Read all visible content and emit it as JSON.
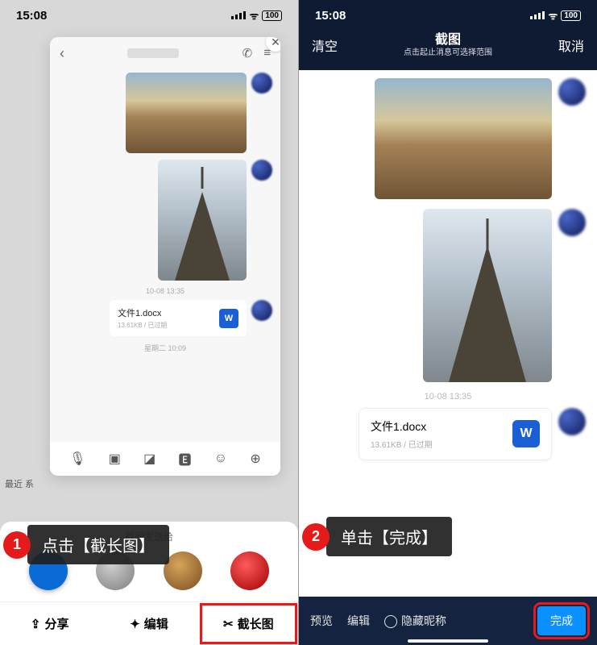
{
  "left": {
    "status": {
      "time": "15:08",
      "battery": "100"
    },
    "side_label": "最近\n系",
    "timestamp1": "10-08 13:35",
    "timestamp2": "星期二 10:09",
    "file": {
      "name": "文件1.docx",
      "meta": "13.61KB / 已过期",
      "badge": "W"
    },
    "tray_title": "截图发送给",
    "actions": {
      "share": "分享",
      "edit": "编辑",
      "long": "截长图"
    }
  },
  "right": {
    "status": {
      "time": "15:08",
      "battery": "100"
    },
    "header": {
      "clear": "清空",
      "title": "截图",
      "subtitle": "点击起止消息可选择范围",
      "cancel": "取消"
    },
    "timestamp": "10-08 13:35",
    "file": {
      "name": "文件1.docx",
      "meta": "13.61KB / 已过期",
      "badge": "W"
    },
    "footer": {
      "preview": "预览",
      "edit": "编辑",
      "hide": "隐藏昵称",
      "done": "完成"
    }
  },
  "callouts": {
    "step1_num": "1",
    "step1_text": "点击【截长图】",
    "step2_num": "2",
    "step2_text": "单击【完成】"
  }
}
